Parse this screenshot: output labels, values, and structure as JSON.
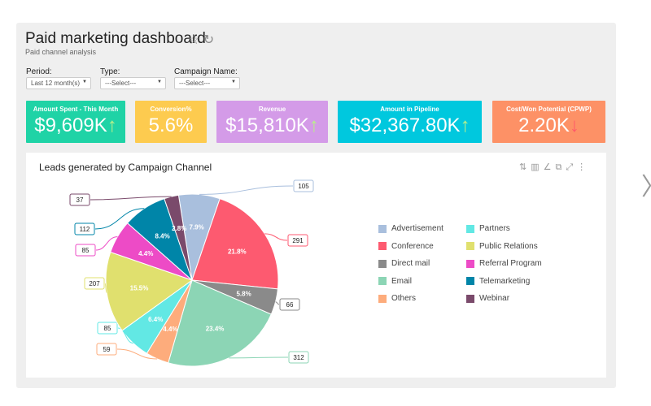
{
  "header": {
    "title": "Paid marketing dashboard",
    "subtitle": "Paid channel analysis",
    "star_icon": "star-icon",
    "refresh_icon": "refresh-icon"
  },
  "filters": [
    {
      "label": "Period:",
      "value": "Last 12 month(s)"
    },
    {
      "label": "Type:",
      "value": "---Select---"
    },
    {
      "label": "Campaign Name:",
      "value": "---Select---"
    }
  ],
  "kpis": [
    {
      "label": "Amount Spent - This Month",
      "value": "$9,609K",
      "trend": "up",
      "arrow": "↑",
      "color": "#1fd3a6"
    },
    {
      "label": "Conversion%",
      "value": "5.6%",
      "trend": "",
      "arrow": "",
      "color": "#fdcb4f"
    },
    {
      "label": "Revenue",
      "value": "$15,810K",
      "trend": "up",
      "arrow": "↑",
      "color": "#d49be8"
    },
    {
      "label": "Amount in Pipeline",
      "value": "$32,367.80K",
      "trend": "up",
      "arrow": "↑",
      "color": "#00c8de"
    },
    {
      "label": "Cost/Won Potential (CPWP)",
      "value": "2.20K",
      "trend": "down",
      "arrow": "↓",
      "color": "#fd9166"
    }
  ],
  "chart_data": {
    "type": "pie",
    "title": "Leads generated by Campaign Channel",
    "legend_position": "right",
    "slices": [
      {
        "name": "Advertisement",
        "value": 105,
        "percent_label": "7.9%",
        "color": "#a9bfdd"
      },
      {
        "name": "Conference",
        "value": 291,
        "percent_label": "21.8%",
        "color": "#fd5a70"
      },
      {
        "name": "Direct mail",
        "value": 66,
        "percent_label": "5.8%",
        "color": "#8a8a8a"
      },
      {
        "name": "Email",
        "value": 312,
        "percent_label": "23.4%",
        "color": "#8cd5b5"
      },
      {
        "name": "Others",
        "value": 59,
        "percent_label": "4.4%",
        "color": "#fdac7c"
      },
      {
        "name": "Partners",
        "value": 85,
        "percent_label": "6.4%",
        "color": "#62e8e4"
      },
      {
        "name": "Public Relations",
        "value": 207,
        "percent_label": "15.5%",
        "color": "#e0e06e"
      },
      {
        "name": "Referral Program",
        "value": 85,
        "percent_label": "4.4%",
        "color": "#ed4bc6"
      },
      {
        "name": "Telemarketing",
        "value": 112,
        "percent_label": "8.4%",
        "color": "#0085a8"
      },
      {
        "name": "Webinar",
        "value": 37,
        "percent_label": "2.8%",
        "color": "#7a4a6b"
      }
    ]
  },
  "toolbar_icons": [
    "sort-icon",
    "bar-chart-icon",
    "chart-type-icon",
    "open-external-icon",
    "expand-icon",
    "more-icon"
  ]
}
